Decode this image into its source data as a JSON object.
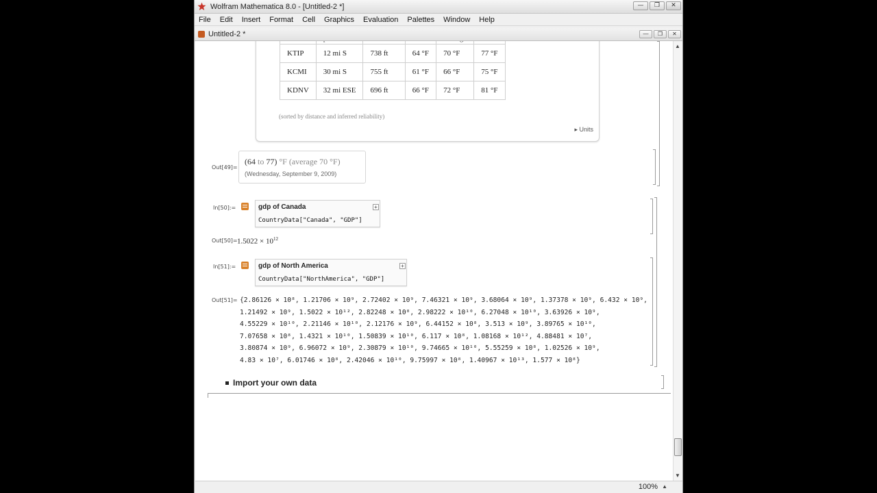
{
  "window": {
    "title": "Wolfram Mathematica 8.0 - [Untitled-2 *]",
    "doc_title": "Untitled-2 *",
    "minimize": "—",
    "restore": "❐",
    "close": "✕"
  },
  "menu": [
    "File",
    "Edit",
    "Insert",
    "Format",
    "Cell",
    "Graphics",
    "Evaluation",
    "Palettes",
    "Window",
    "Help"
  ],
  "weather_table": {
    "headers": [
      "",
      "position",
      "elevation",
      "min",
      "average",
      "max"
    ],
    "rows": [
      [
        "KTIP",
        "12 mi  S",
        "738 ft",
        "64 °F",
        "70 °F",
        "77 °F"
      ],
      [
        "KCMI",
        "30 mi  S",
        "755 ft",
        "61 °F",
        "66 °F",
        "75 °F"
      ],
      [
        "KDNV",
        "32 mi  ESE",
        "696 ft",
        "66 °F",
        "72 °F",
        "81 °F"
      ]
    ],
    "note": "(sorted by distance and inferred reliability)",
    "units_link": "▸ Units"
  },
  "cells": {
    "out49_label": "Out[49]=",
    "out49_range_open": "(64",
    "out49_to": " to ",
    "out49_range_close": "77)",
    "out49_unit": " °F ",
    "out49_avg": "(average  70 °F)",
    "out49_date": "(Wednesday, September 9, 2009)",
    "in50_label": "In[50]:=",
    "in50_query": "gdp of Canada",
    "in50_code": "CountryData[\"Canada\", \"GDP\"]",
    "out50_label": "Out[50]=",
    "out50_mantissa": "1.5022 × 10",
    "out50_exp": "12",
    "in51_label": "In[51]:=",
    "in51_query": "gdp of North America",
    "in51_code": "CountryData[\"NorthAmerica\", \"GDP\"]",
    "out51_label": "Out[51]="
  },
  "out51_lines": [
    "{2.86126 × 10⁸, 1.21706 × 10⁹, 2.72402 × 10⁹, 7.46321 × 10⁹, 3.68064 × 10⁹, 1.37378 × 10⁹, 6.432 × 10⁹,",
    " 1.21492 × 10⁹, 1.5022 × 10¹², 2.82248 × 10⁸, 2.98222 × 10¹⁰, 6.27048 × 10¹⁰, 3.63926 × 10⁹,",
    " 4.55229 × 10¹⁰, 2.21146 × 10¹⁰, 2.12176 × 10⁹, 6.44152 × 10⁸, 3.513 × 10⁹, 3.89765 × 10¹⁰,",
    " 7.07658 × 10⁸, 1.4321 × 10¹⁰, 1.50839 × 10¹⁰, 6.117 × 10⁸, 1.08168 × 10¹², 4.88481 × 10⁷,",
    " 3.80874 × 10⁹, 6.96072 × 10⁹, 2.30879 × 10¹⁰, 9.74665 × 10¹⁰, 5.55259 × 10⁸, 1.02526 × 10⁹,",
    " 4.83 × 10⁷, 6.01746 × 10⁸, 2.42046 × 10¹⁰, 9.75997 × 10⁸, 1.40967 × 10¹³, 1.577 × 10⁸}"
  ],
  "section": {
    "title": "Import your own data"
  },
  "status": {
    "zoom": "100%"
  }
}
